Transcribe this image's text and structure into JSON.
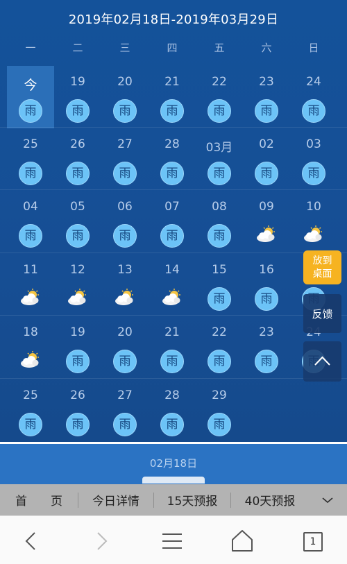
{
  "calendar": {
    "title": "2019年02月18日-2019年03月29日",
    "weekdays": [
      "一",
      "二",
      "三",
      "四",
      "五",
      "六",
      "日"
    ],
    "rain_label": "雨",
    "rows": [
      [
        {
          "label": "今",
          "weather": "rain",
          "today": true
        },
        {
          "label": "19",
          "weather": "rain"
        },
        {
          "label": "20",
          "weather": "rain"
        },
        {
          "label": "21",
          "weather": "rain"
        },
        {
          "label": "22",
          "weather": "rain"
        },
        {
          "label": "23",
          "weather": "rain"
        },
        {
          "label": "24",
          "weather": "rain"
        }
      ],
      [
        {
          "label": "25",
          "weather": "rain"
        },
        {
          "label": "26",
          "weather": "rain"
        },
        {
          "label": "27",
          "weather": "rain"
        },
        {
          "label": "28",
          "weather": "rain"
        },
        {
          "label": "03月",
          "weather": "rain"
        },
        {
          "label": "02",
          "weather": "rain"
        },
        {
          "label": "03",
          "weather": "rain"
        }
      ],
      [
        {
          "label": "04",
          "weather": "rain"
        },
        {
          "label": "05",
          "weather": "rain"
        },
        {
          "label": "06",
          "weather": "rain"
        },
        {
          "label": "07",
          "weather": "rain"
        },
        {
          "label": "08",
          "weather": "rain"
        },
        {
          "label": "09",
          "weather": "partly-cloudy"
        },
        {
          "label": "10",
          "weather": "partly-cloudy"
        }
      ],
      [
        {
          "label": "11",
          "weather": "partly-cloudy"
        },
        {
          "label": "12",
          "weather": "partly-cloudy"
        },
        {
          "label": "13",
          "weather": "partly-cloudy"
        },
        {
          "label": "14",
          "weather": "partly-cloudy"
        },
        {
          "label": "15",
          "weather": "rain"
        },
        {
          "label": "16",
          "weather": "rain"
        },
        {
          "label": "",
          "weather": "rain"
        }
      ],
      [
        {
          "label": "18",
          "weather": "partly-cloudy"
        },
        {
          "label": "19",
          "weather": "rain"
        },
        {
          "label": "20",
          "weather": "rain"
        },
        {
          "label": "21",
          "weather": "rain"
        },
        {
          "label": "22",
          "weather": "rain"
        },
        {
          "label": "23",
          "weather": "rain"
        },
        {
          "label": "24",
          "weather": "rain"
        }
      ],
      [
        {
          "label": "25",
          "weather": "rain"
        },
        {
          "label": "26",
          "weather": "rain"
        },
        {
          "label": "27",
          "weather": "rain"
        },
        {
          "label": "28",
          "weather": "rain"
        },
        {
          "label": "29",
          "weather": "rain"
        }
      ]
    ]
  },
  "floating": {
    "desktop_line1": "放到",
    "desktop_line2": "桌面",
    "feedback": "反馈",
    "back_to_top_icon": "chevron-up-icon"
  },
  "selected_date": "02月18日",
  "tabs": [
    "首　　页",
    "今日详情",
    "15天预报",
    "40天预报"
  ],
  "tabs_more_icon": "chevron-down-icon",
  "toolbar": {
    "back_icon": "back-arrow-icon",
    "forward_icon": "forward-arrow-icon",
    "menu_icon": "menu-icon",
    "home_icon": "home-icon",
    "tab_count": "1"
  },
  "colors": {
    "calendar_bg": "#14529a",
    "today_highlight": "#2b6fb8",
    "rain_badge": "#6cc3f7",
    "desktop_button": "#f6b321",
    "date_strip": "#2b73c3",
    "tabbar_bg": "#b3b3b3"
  }
}
